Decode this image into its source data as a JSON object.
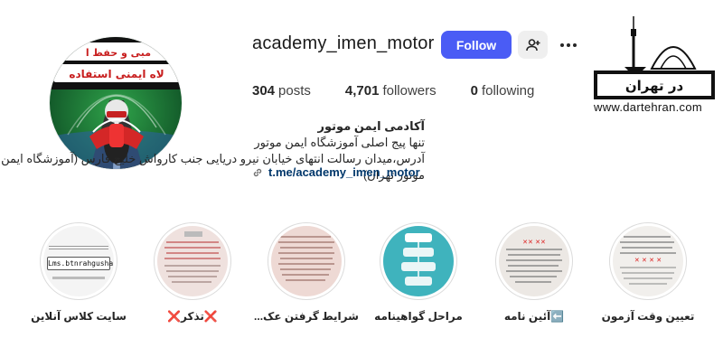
{
  "profile": {
    "username": "academy_imen_motor",
    "follow_label": "Follow",
    "stats": {
      "posts_count": "304",
      "posts_label": "posts",
      "followers_count": "4,701",
      "followers_label": "followers",
      "following_count": "0",
      "following_label": "following"
    },
    "bio": {
      "name": "آکادمی ایمن موتور",
      "line1": "تنها پیج اصلی آموزشگاه ایمن موتور",
      "line2": "آدرس،میدان رسالت انتهای خیابان نیرو دریایی جنب کارواش خلیج فارس (آموزشگاه ایمن موتور تهران)",
      "link": "t.me/academy_imen_motor"
    },
    "avatar_banner_text": "مبی و حفظ ا... لاه ایمنی استفاده"
  },
  "watermark": {
    "title": "در تهران",
    "url": "www.dartehran.com"
  },
  "highlights": [
    {
      "label": "تعیین وقت آزمون"
    },
    {
      "label": "⬅️آئین نامه"
    },
    {
      "label": "مراحل گواهینامه"
    },
    {
      "label": "شرایط گرفتن عک..."
    },
    {
      "label": "❌تذکر❌"
    },
    {
      "label": "سایت کلاس آنلاین",
      "thumb_text": "Lms.btnrahgusha.ir"
    }
  ],
  "colors": {
    "follow_button": "#4a5cf5",
    "link": "#00376b",
    "avatar_bg": "#1d7a3a"
  },
  "icons": {
    "suggest": "person-add-icon",
    "more": "more-dots-icon",
    "link": "chain-link-icon"
  }
}
